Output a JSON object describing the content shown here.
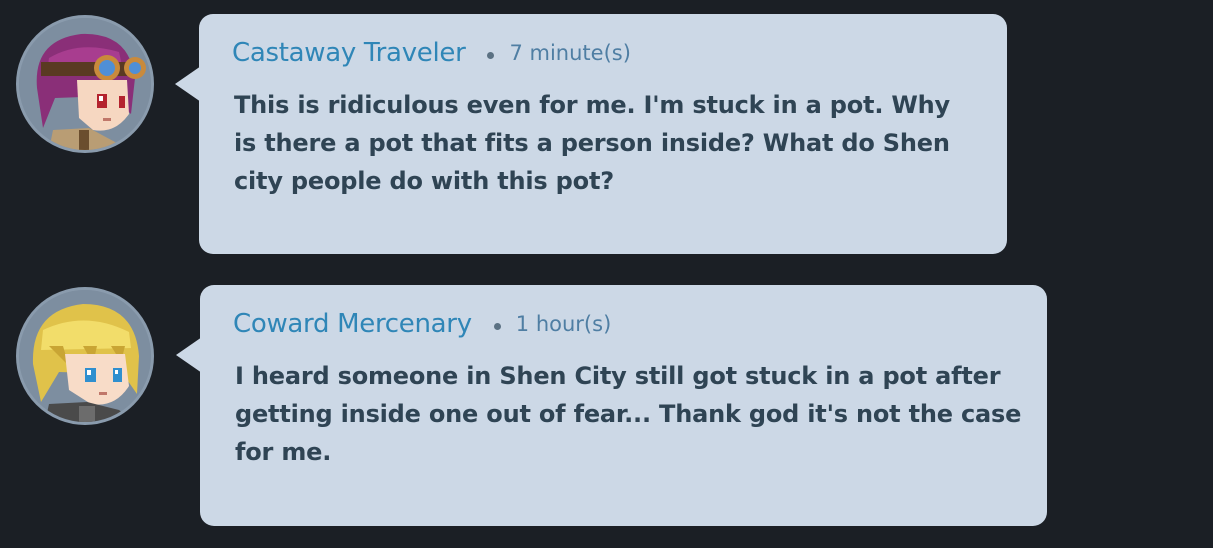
{
  "posts": [
    {
      "author": "Castaway Traveler",
      "time": "7 minute(s)",
      "message": "This is ridiculous even for me. I'm stuck in a pot. Why is there a pot that fits a person inside? What do Shen city people do with this pot?",
      "avatar_icon": "pink-haired-goggles-character-icon"
    },
    {
      "author": "Coward Mercenary",
      "time": "1 hour(s)",
      "message": "I heard someone in Shen City still got stuck in a pot after getting inside one out of fear... Thank god it's not the case for me.",
      "avatar_icon": "blonde-haired-character-icon"
    }
  ],
  "colors": {
    "background": "#1b1f25",
    "bubble": "#ccd8e6",
    "author": "#2f86b7",
    "time": "#4f7ea3",
    "message": "#2f4454"
  }
}
